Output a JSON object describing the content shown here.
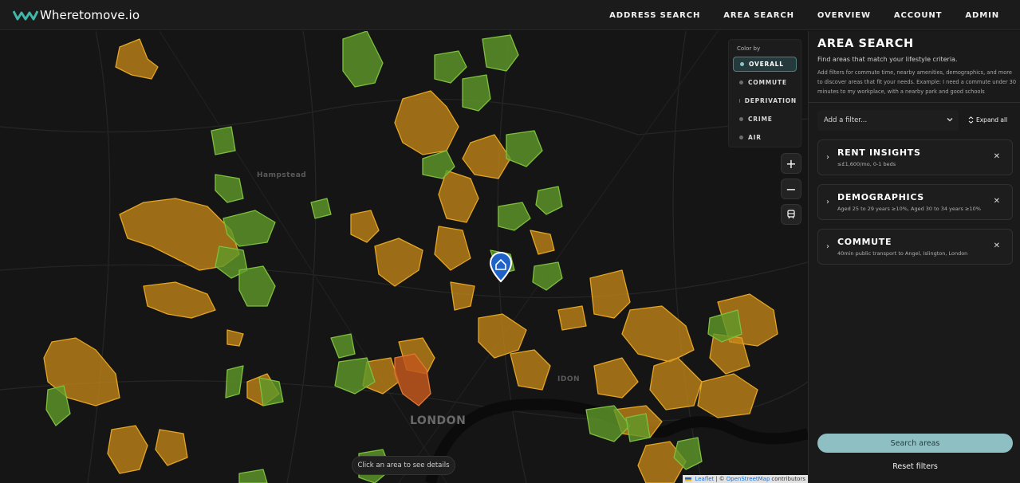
{
  "brand": {
    "name": "Wheretomove.io"
  },
  "nav": {
    "items": [
      "ADDRESS SEARCH",
      "AREA SEARCH",
      "OVERVIEW",
      "ACCOUNT",
      "ADMIN"
    ]
  },
  "map": {
    "labels": {
      "hampstead": "Hampstead",
      "london": "LONDON",
      "idon": "IDON"
    },
    "color_by": {
      "title": "Color by",
      "options": [
        "OVERALL",
        "COMMUTE",
        "DEPRIVATION",
        "CRIME",
        "AIR"
      ],
      "selected": "OVERALL"
    },
    "controls": {
      "zoom_in": "+",
      "zoom_out": "−"
    },
    "hint": "Click an area to see details",
    "attribution": {
      "leaflet": "Leaflet",
      "sep": "|",
      "copy": "©",
      "osm": "OpenStreetMap",
      "contributors": "contributors"
    },
    "colors": {
      "green": "#5f9a2a",
      "amber": "#c98a18",
      "orange": "#c0571c",
      "marker": "#1f63c9"
    }
  },
  "panel": {
    "title": "AREA SEARCH",
    "subtitle": "Find areas that match your lifestyle criteria.",
    "description": "Add filters for commute time, nearby amenities, demographics, and more to discover areas that fit your needs. Example: I need a commute under 30 minutes to my workplace, with a nearby park and good schools",
    "add_filter_placeholder": "Add a filter...",
    "expand_all": "Expand all",
    "filters": [
      {
        "name": "RENT INSIGHTS",
        "detail": "≤£1,600/mo, 0-1 beds"
      },
      {
        "name": "DEMOGRAPHICS",
        "detail": "Aged 25 to 29 years ≥10%, Aged 30 to 34 years ≥10%"
      },
      {
        "name": "COMMUTE",
        "detail": "40min public transport to Angel, Islington, London"
      }
    ],
    "search_button": "Search areas",
    "reset_button": "Reset filters",
    "accent": "#8ec0c3"
  }
}
